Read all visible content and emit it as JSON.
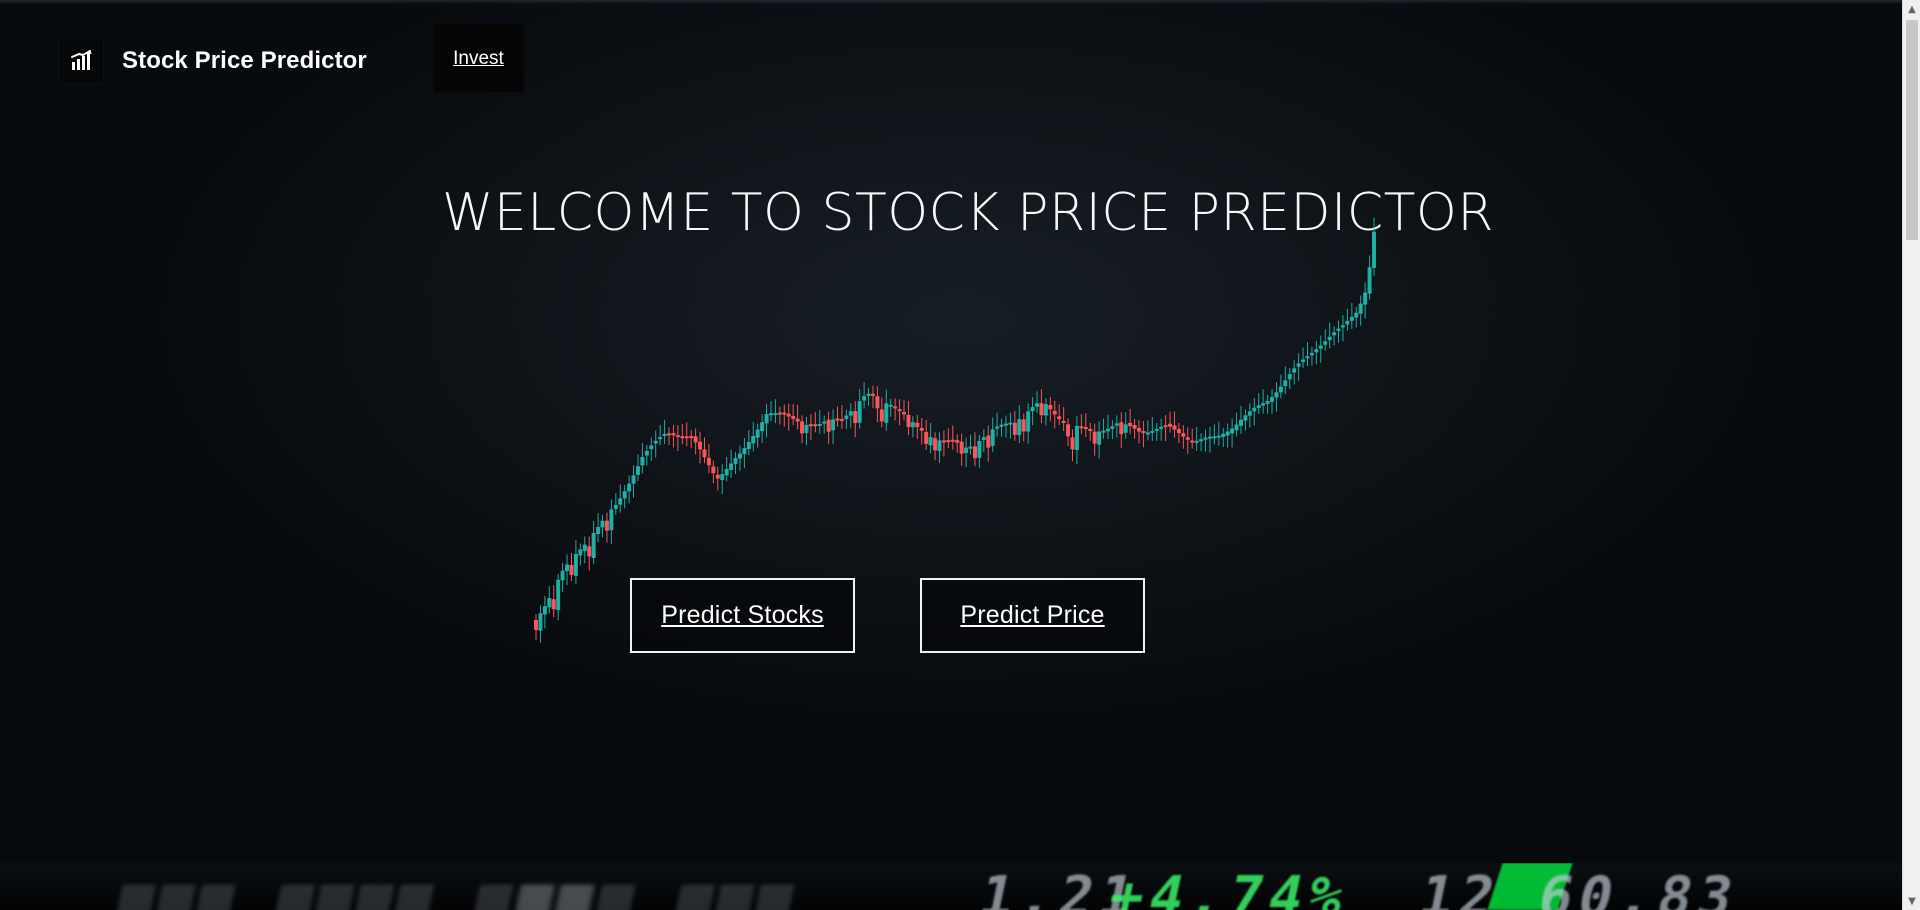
{
  "header": {
    "brand_title": "Stock Price Predictor",
    "logo_icon": "bar-chart-icon",
    "nav_items": [
      {
        "label": "Invest"
      }
    ]
  },
  "hero": {
    "title": "WELCOME TO STOCK PRICE PREDICTOR",
    "buttons": [
      {
        "label": "Predict Stocks"
      },
      {
        "label": "Predict Price"
      }
    ]
  },
  "ticker": {
    "items": [
      {
        "text": "1.21",
        "tone": "bright"
      },
      {
        "text": "+4.74%",
        "tone": "green"
      },
      {
        "text": "12 60.83",
        "tone": "bright"
      }
    ]
  },
  "colors": {
    "background": "#0b0f14",
    "text_primary": "#ffffff",
    "candle_up": "#1fb5a8",
    "candle_down": "#ff5a5f",
    "ticker_green": "#00ff46"
  },
  "scrollbar": {
    "visible": true
  }
}
